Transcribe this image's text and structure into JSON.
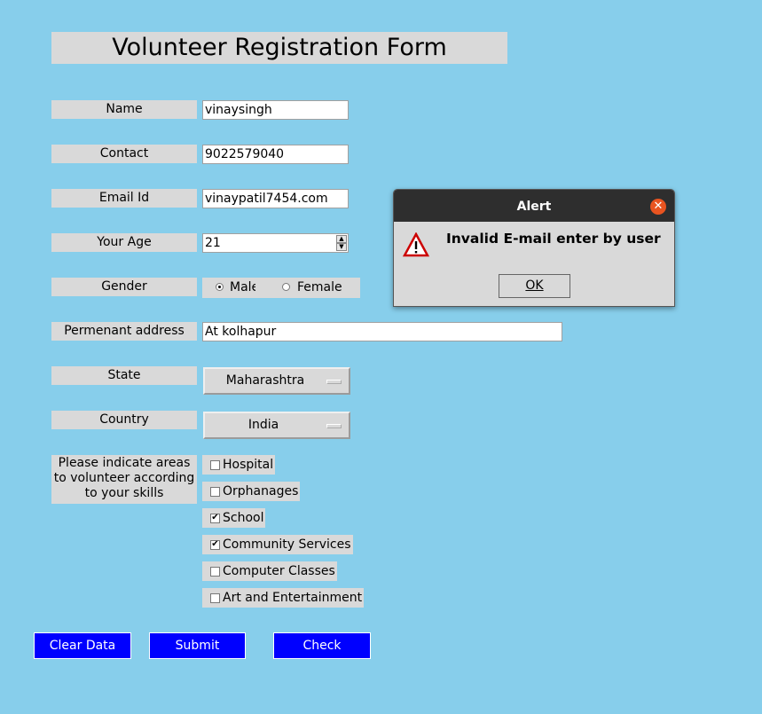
{
  "form": {
    "title": "Volunteer Registration Form",
    "labels": {
      "name": "Name",
      "contact": "Contact",
      "email": "Email Id",
      "age": "Your Age",
      "gender": "Gender",
      "address": "Permenant address",
      "state": "State",
      "country": "Country",
      "areas": "Please indicate areas to volunteer according to your skills"
    },
    "values": {
      "name": "vinaysingh",
      "contact": "9022579040",
      "email": "vinaypatil7454.com",
      "age": "21",
      "address": "At kolhapur",
      "state": "Maharashtra",
      "country": "India"
    },
    "gender_options": [
      {
        "label": "Male",
        "selected": true
      },
      {
        "label": "Female",
        "selected": false
      }
    ],
    "areas": [
      {
        "label": "Hospital",
        "checked": false
      },
      {
        "label": "Orphanages",
        "checked": false
      },
      {
        "label": "School",
        "checked": true
      },
      {
        "label": "Community Services",
        "checked": true
      },
      {
        "label": "Computer Classes",
        "checked": false
      },
      {
        "label": "Art and Entertainment",
        "checked": false
      }
    ],
    "buttons": {
      "clear": "Clear Data",
      "submit": "Submit",
      "check": "Check"
    }
  },
  "dialog": {
    "title": "Alert",
    "message": "Invalid E-mail enter by user",
    "ok": "OK",
    "close_icon": "close-icon",
    "warning_icon": "warning-icon"
  },
  "colors": {
    "background": "#87CEEB",
    "panel": "#d9d9d9",
    "button": "#0000ff",
    "close": "#e95420"
  }
}
